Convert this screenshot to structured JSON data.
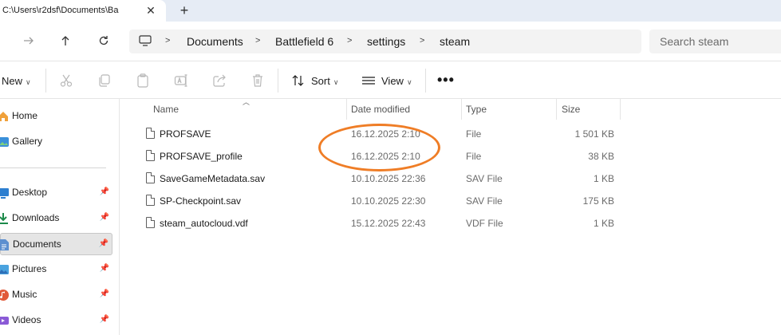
{
  "tab": {
    "title": "C:\\Users\\r2dsf\\Documents\\Ba",
    "close": "✕",
    "new_tab": "+"
  },
  "nav": {
    "back_icon": "arrow-left-icon",
    "forward_icon": "arrow-right-icon",
    "up_icon": "arrow-up-icon",
    "refresh_icon": "refresh-icon"
  },
  "breadcrumb": [
    "Documents",
    "Battlefield 6",
    "settings",
    "steam"
  ],
  "search": {
    "placeholder": "Search steam"
  },
  "commandbar": {
    "new_label": "New",
    "sort_label": "Sort",
    "view_label": "View",
    "more_label": "•••"
  },
  "sidebar": {
    "items": [
      {
        "label": "Home",
        "icon": "home-icon",
        "pinned": false,
        "selected": false
      },
      {
        "label": "Gallery",
        "icon": "gallery-icon",
        "pinned": false,
        "selected": false
      },
      {
        "label": "Desktop",
        "icon": "desktop-icon",
        "pinned": true,
        "selected": false
      },
      {
        "label": "Downloads",
        "icon": "downloads-icon",
        "pinned": true,
        "selected": false
      },
      {
        "label": "Documents",
        "icon": "documents-icon",
        "pinned": true,
        "selected": true
      },
      {
        "label": "Pictures",
        "icon": "pictures-icon",
        "pinned": true,
        "selected": false
      },
      {
        "label": "Music",
        "icon": "music-icon",
        "pinned": true,
        "selected": false
      },
      {
        "label": "Videos",
        "icon": "videos-icon",
        "pinned": true,
        "selected": false
      }
    ]
  },
  "columns": {
    "name": "Name",
    "date": "Date modified",
    "type": "Type",
    "size": "Size"
  },
  "files": [
    {
      "name": "PROFSAVE",
      "date": "16.12.2025 2:10",
      "type": "File",
      "size": "1 501 KB"
    },
    {
      "name": "PROFSAVE_profile",
      "date": "16.12.2025 2:10",
      "type": "File",
      "size": "38 KB"
    },
    {
      "name": "SaveGameMetadata.sav",
      "date": "10.10.2025 22:36",
      "type": "SAV File",
      "size": "1 KB"
    },
    {
      "name": "SP-Checkpoint.sav",
      "date": "10.10.2025 22:30",
      "type": "SAV File",
      "size": "175 KB"
    },
    {
      "name": "steam_autocloud.vdf",
      "date": "15.12.2025 22:43",
      "type": "VDF File",
      "size": "1 KB"
    }
  ],
  "colors": {
    "accent": "#0067c0",
    "annotation": "#ef7d26",
    "selection": "#e5e5e5"
  }
}
